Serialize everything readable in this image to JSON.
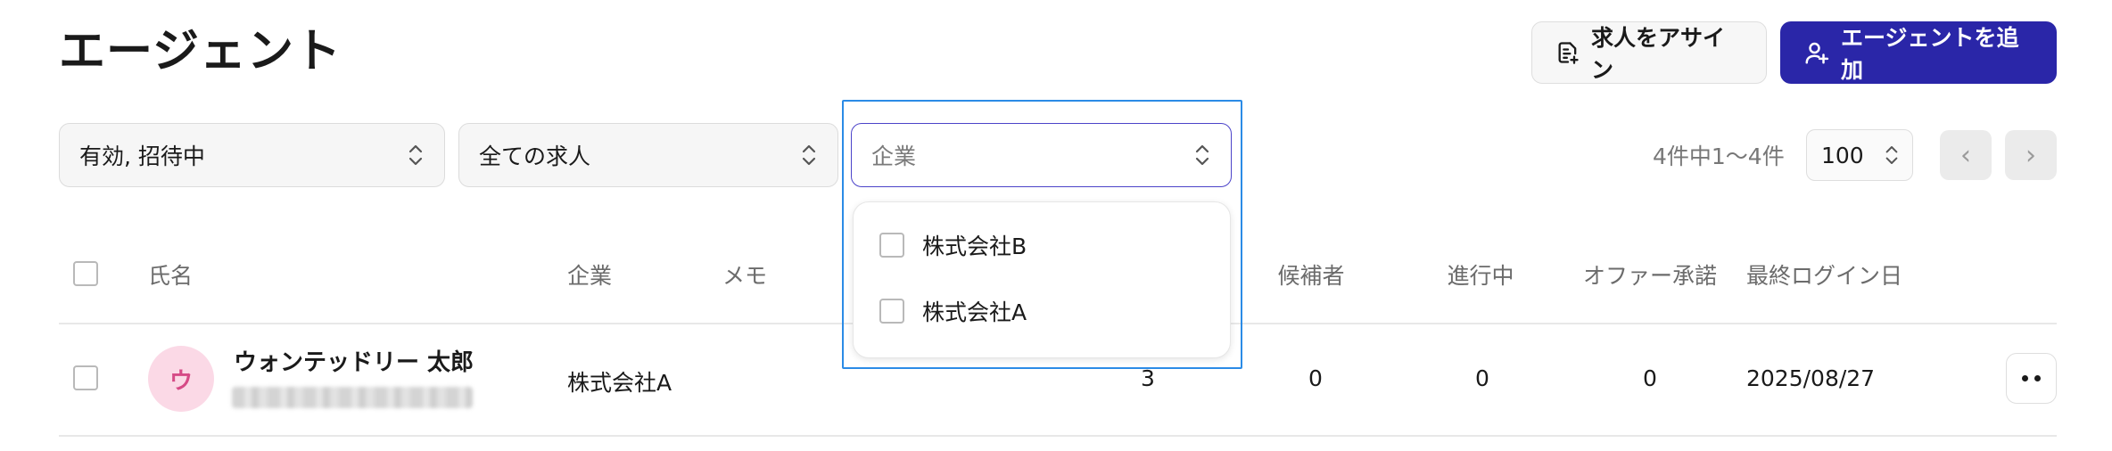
{
  "page": {
    "title": "エージェント"
  },
  "header": {
    "assign_label": "求人をアサイン",
    "add_label": "エージェントを追加"
  },
  "filters": {
    "status": "有効, 招待中",
    "jobs": "全ての求人",
    "company_placeholder": "企業",
    "company_options": [
      "株式会社B",
      "株式会社A"
    ]
  },
  "pagination": {
    "range_text": "4件中1〜4件",
    "per_page": "100",
    "prev": "‹",
    "next": "›"
  },
  "table": {
    "headers": [
      "氏名",
      "企業",
      "メモ",
      "候補者",
      "進行中",
      "オファー承諾",
      "最終ログイン日"
    ],
    "rows": [
      {
        "avatar_initial": "ウ",
        "name": "ウォンテッドリー 太郎",
        "company": "株式会社A",
        "jobs_count": "3",
        "candidates": "0",
        "in_progress": "0",
        "offers_accepted": "0",
        "last_login": "2025/08/27"
      }
    ]
  },
  "icons": [
    "document-plus-icon",
    "user-plus-icon",
    "chevron-updown-icon",
    "chevron-left-icon",
    "chevron-right-icon",
    "more-horizontal-icon"
  ],
  "colors": {
    "primary": "#2a26a8",
    "focus": "#2b8be6",
    "avatar_bg": "#fbd9e6",
    "avatar_fg": "#d64a86"
  }
}
